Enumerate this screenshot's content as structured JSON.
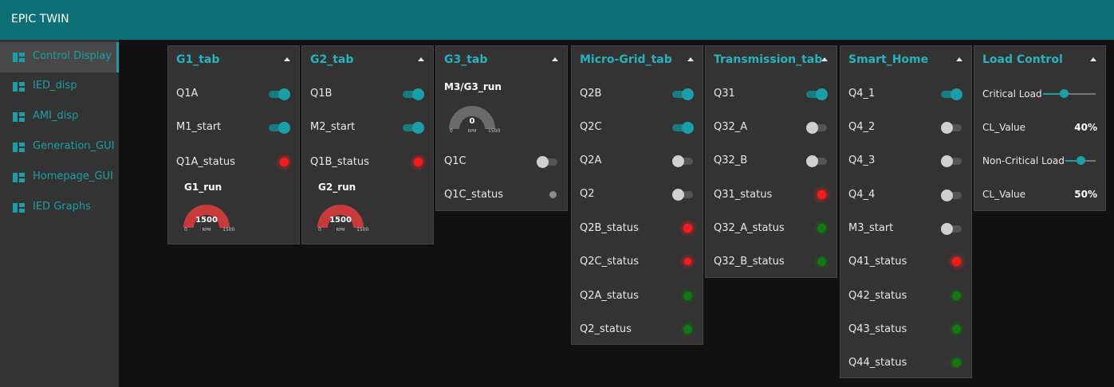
{
  "app": {
    "title": "EPIC TWIN"
  },
  "sidebar": {
    "items": [
      {
        "label": "Control Display",
        "icon": "dashboard-icon",
        "active": true
      },
      {
        "label": "IED_disp",
        "icon": "dashboard-icon"
      },
      {
        "label": "AMI_disp",
        "icon": "dashboard-icon"
      },
      {
        "label": "Generation_GUI",
        "icon": "dashboard-icon"
      },
      {
        "label": "Homepage_GUI",
        "icon": "dashboard-icon"
      },
      {
        "label": "IED Graphs",
        "icon": "dashboard-icon"
      }
    ]
  },
  "colors": {
    "accent": "#1a9fa8",
    "header": "#0e7075",
    "status_red": "#ff1a1a",
    "status_green": "#0f7a0f",
    "gauge_red": "#c93a3a",
    "gauge_grey": "#6a6a6a"
  },
  "cards": {
    "g1": {
      "title": "G1_tab",
      "q1a": {
        "label": "Q1A",
        "on": true
      },
      "m1_start": {
        "label": "M1_start",
        "on": true
      },
      "q1a_status": {
        "label": "Q1A_status",
        "state": "red"
      },
      "gauge": {
        "title": "G1_run",
        "value": "1500",
        "unit": "RPM",
        "min": "0",
        "max": "1500"
      }
    },
    "g2": {
      "title": "G2_tab",
      "q1b": {
        "label": "Q1B",
        "on": true
      },
      "m2_start": {
        "label": "M2_start",
        "on": true
      },
      "q1b_status": {
        "label": "Q1B_status",
        "state": "red"
      },
      "gauge": {
        "title": "G2_run",
        "value": "1500",
        "unit": "RPM",
        "min": "0",
        "max": "1500"
      }
    },
    "g3": {
      "title": "G3_tab",
      "gauge": {
        "title": "M3/G3_run",
        "value": "0",
        "unit": "RPM",
        "min": "0",
        "max": "1500"
      },
      "q1c": {
        "label": "Q1C",
        "on": false
      },
      "q1c_status": {
        "label": "Q1C_status",
        "state": "grey"
      }
    },
    "microgrid": {
      "title": "Micro-Grid_tab",
      "rows": [
        {
          "label": "Q2B",
          "type": "toggle",
          "on": true
        },
        {
          "label": "Q2C",
          "type": "toggle",
          "on": true
        },
        {
          "label": "Q2A",
          "type": "toggle",
          "on": false
        },
        {
          "label": "Q2",
          "type": "toggle",
          "on": false
        },
        {
          "label": "Q2B_status",
          "type": "led",
          "state": "red"
        },
        {
          "label": "Q2C_status",
          "type": "led",
          "state": "red"
        },
        {
          "label": "Q2A_status",
          "type": "led",
          "state": "green"
        },
        {
          "label": "Q2_status",
          "type": "led",
          "state": "green"
        }
      ]
    },
    "transmission": {
      "title": "Transmission_tab",
      "rows": [
        {
          "label": "Q31",
          "type": "toggle",
          "on": true
        },
        {
          "label": "Q32_A",
          "type": "toggle",
          "on": false
        },
        {
          "label": "Q32_B",
          "type": "toggle",
          "on": false
        },
        {
          "label": "Q31_status",
          "type": "led",
          "state": "red"
        },
        {
          "label": "Q32_A_status",
          "type": "led",
          "state": "green"
        },
        {
          "label": "Q32_B_status",
          "type": "led",
          "state": "green"
        }
      ]
    },
    "smarthome": {
      "title": "Smart_Home",
      "rows": [
        {
          "label": "Q4_1",
          "type": "toggle",
          "on": true
        },
        {
          "label": "Q4_2",
          "type": "toggle",
          "on": false
        },
        {
          "label": "Q4_3",
          "type": "toggle",
          "on": false
        },
        {
          "label": "Q4_4",
          "type": "toggle",
          "on": false
        },
        {
          "label": "M3_start",
          "type": "toggle",
          "on": false
        },
        {
          "label": "Q41_status",
          "type": "led",
          "state": "red"
        },
        {
          "label": "Q42_status",
          "type": "led",
          "state": "green"
        },
        {
          "label": "Q43_status",
          "type": "led",
          "state": "green"
        },
        {
          "label": "Q44_status",
          "type": "led",
          "state": "green"
        }
      ]
    },
    "loadcontrol": {
      "title": "Load Control",
      "critical": {
        "label": "Critical Load",
        "level": 0.4
      },
      "critical_value": {
        "label": "CL_Value",
        "value": "40%"
      },
      "noncritical": {
        "label": "Non-Critical Load",
        "level": 0.5
      },
      "noncritical_value": {
        "label": "CL_Value",
        "value": "50%"
      }
    }
  }
}
